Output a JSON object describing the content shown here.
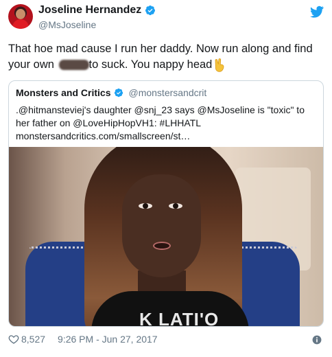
{
  "author": {
    "display_name": "Joseline Hernandez",
    "handle": "@MsJoseline"
  },
  "tweet": {
    "line1": "That hoe mad cause I run her daddy. Now run along and find",
    "line2_before": "your own ",
    "line2_after": "to suck.  You nappy head"
  },
  "quoted": {
    "display_name": "Monsters and Critics",
    "handle": "@monstersandcrit",
    "line1": ".@hitmansteviej's daughter @snj_23 says @MsJoseline is \"toxic\" to",
    "line2": "her father on @LoveHipHopVH1: #LHHATL",
    "line3": "monstersandcritics.com/smallscreen/st…",
    "image_shirt_text": "K     LATI'O"
  },
  "footer": {
    "likes": "8,527",
    "timestamp": "9:26 PM - Jun 27, 2017"
  },
  "icons": {
    "verified": "verified-badge-icon",
    "bird": "twitter-bird-icon",
    "heart": "heart-icon",
    "info": "info-icon",
    "peace": "victory-hand-emoji"
  },
  "colors": {
    "twitter_blue": "#1da1f2",
    "secondary_text": "#657786",
    "border": "#ccd6dd"
  }
}
